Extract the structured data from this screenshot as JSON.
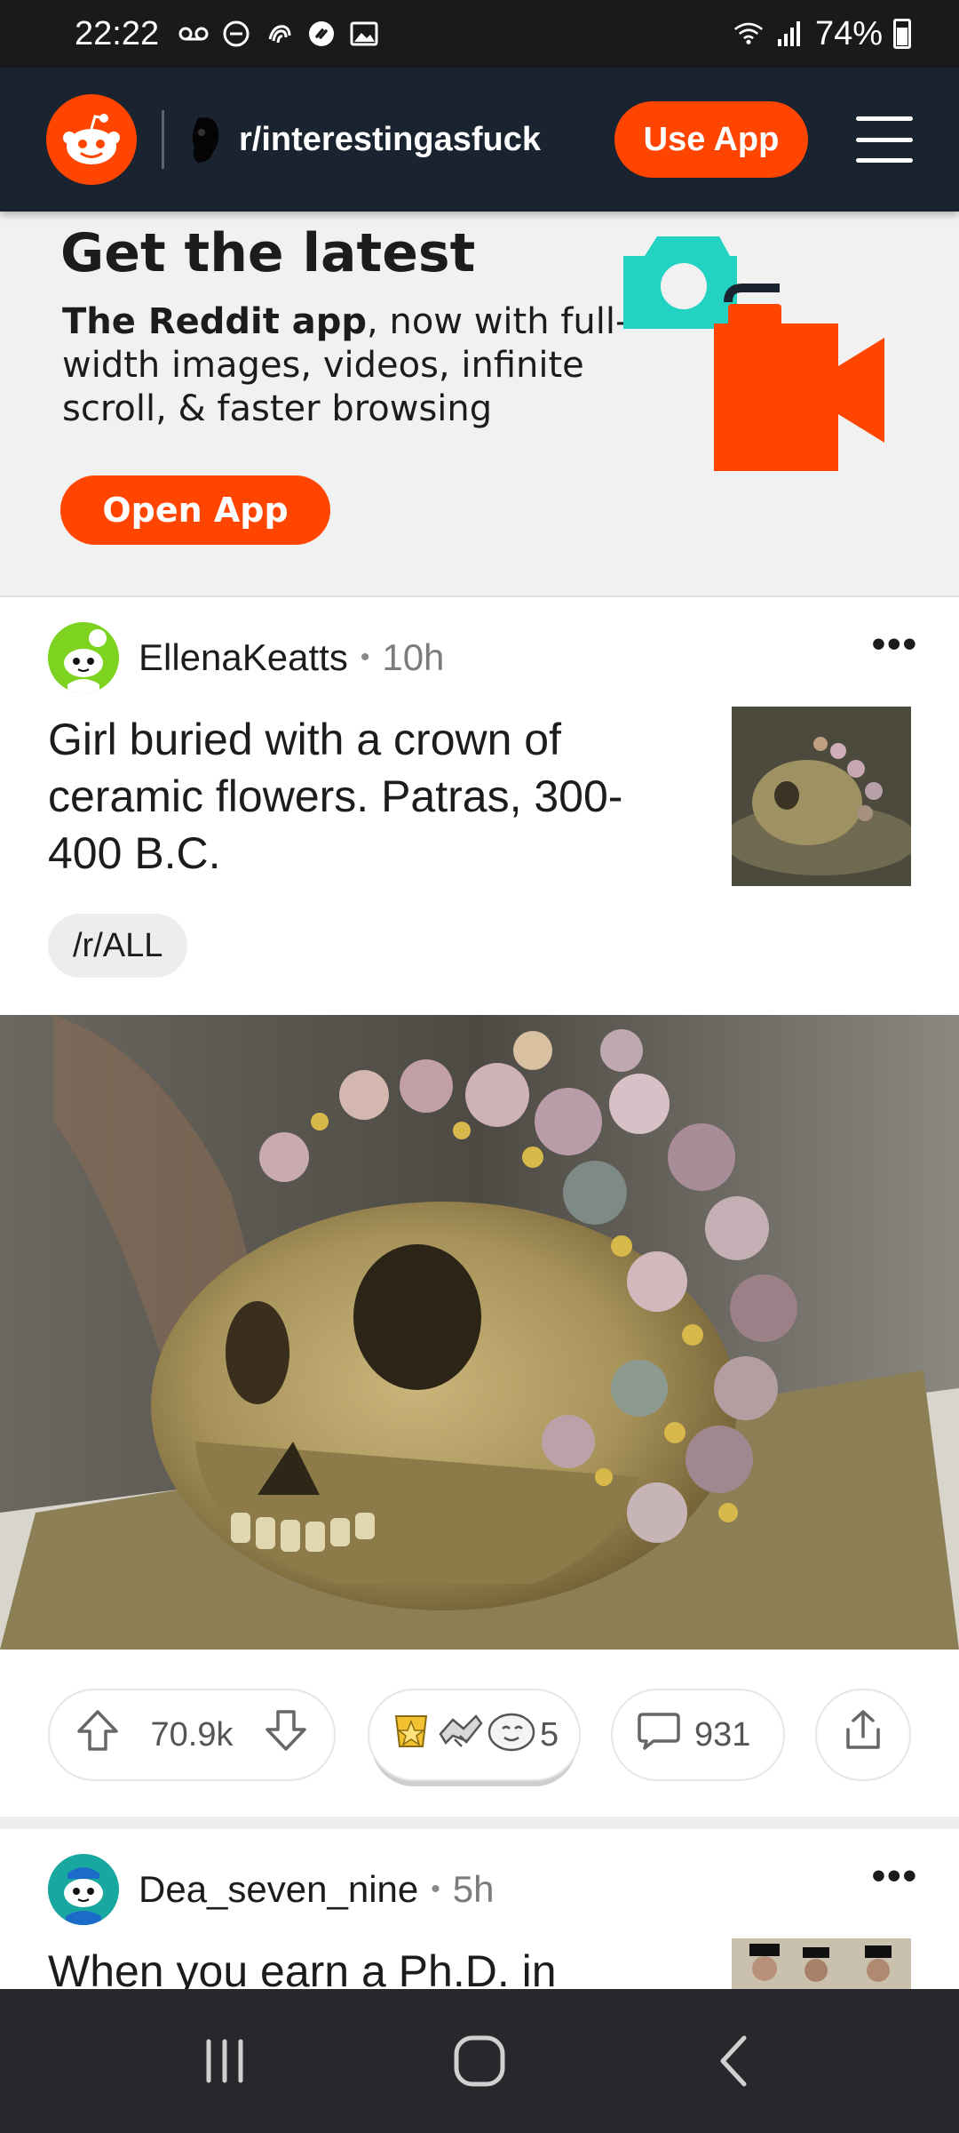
{
  "status_bar": {
    "time": "22:22",
    "battery": "74%",
    "left_icons": [
      "voicemail-icon",
      "do-not-disturb-icon",
      "fingerprint-icon",
      "shazam-icon",
      "gallery-icon"
    ],
    "right_icons": [
      "wifi-icon",
      "signal-icon",
      "battery-icon"
    ]
  },
  "header": {
    "subreddit": "r/interestingasfuck",
    "use_app_label": "Use App",
    "colors": {
      "bg": "#1a2330",
      "accent": "#ff4500"
    }
  },
  "promo": {
    "title": "Get the latest",
    "text_bold": "The Reddit app",
    "text_rest": ", now with full-width images, videos, infinite scroll, & faster browsing",
    "button_label": "Open App",
    "colors": {
      "camera": "#24d2c4",
      "video": "#ff4500"
    }
  },
  "post": {
    "username": "EllenaKeatts",
    "age": "10h",
    "more": "•••",
    "title": "Girl buried with a crown of ceramic flowers. Patras, 300-400 B.C.",
    "flair": "/r/ALL",
    "upvotes": "70.9k",
    "award_count": "5",
    "comments": "931"
  },
  "post2": {
    "username": "Dea_seven_nine",
    "age": "5h",
    "more": "•••",
    "title": "When you earn a Ph.D. in"
  },
  "nav": {
    "icons": [
      "recent-apps-icon",
      "home-icon",
      "back-icon"
    ]
  }
}
